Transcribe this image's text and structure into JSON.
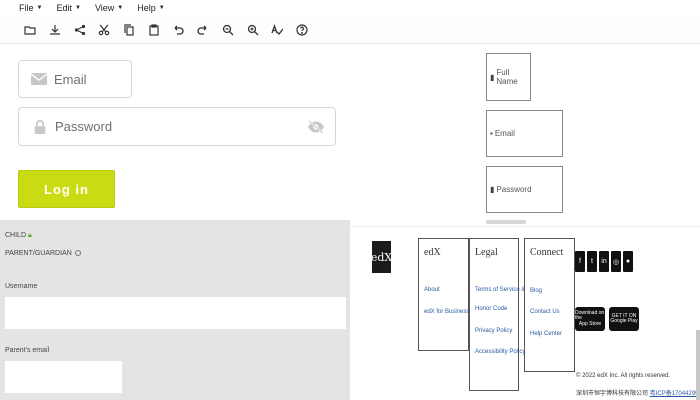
{
  "menu": {
    "items": [
      "File",
      "Edit",
      "View",
      "Help"
    ]
  },
  "toolbar": {
    "icons": [
      "folder-icon",
      "download-icon",
      "share-icon",
      "cut-icon",
      "copy-icon",
      "paste-icon",
      "undo-icon",
      "redo-icon",
      "zoom-out-icon",
      "zoom-in-icon",
      "spellcheck-icon",
      "help-icon"
    ]
  },
  "login": {
    "email_placeholder": "Email",
    "password_placeholder": "Password",
    "login_button": "Log in",
    "accent_color": "#c9dc13"
  },
  "signup_column": {
    "full_name": "Full Name",
    "email": "Email",
    "password": "Password"
  },
  "signup_panel": {
    "child_label": "CHILD",
    "parent_label": "PARENT/GUARDIAN",
    "username_label": "Username",
    "parent_email_label": "Parent's email"
  },
  "footer": {
    "logo": "edX",
    "columns": [
      {
        "title": "edX",
        "links": [
          "About",
          "edX for Business"
        ]
      },
      {
        "title": "Legal",
        "links": [
          "Terms of Service &",
          "Honor Code",
          "Privacy Policy",
          "Accessibility Policy"
        ]
      },
      {
        "title": "Connect",
        "links": [
          "Blog",
          "Contact Us",
          "Help Center"
        ]
      }
    ],
    "social": [
      "f",
      "t",
      "in",
      "◎",
      "●"
    ],
    "app_store": {
      "top": "Download on the",
      "bottom": "App Store"
    },
    "google_play": {
      "top": "GET IT ON",
      "bottom": "Google Play"
    },
    "copyright": "© 2022 edX Inc. All rights reserved.",
    "icp_text": "深圳市恒宇博科技有限公司",
    "icp_link": "粤ICP备17044299"
  }
}
